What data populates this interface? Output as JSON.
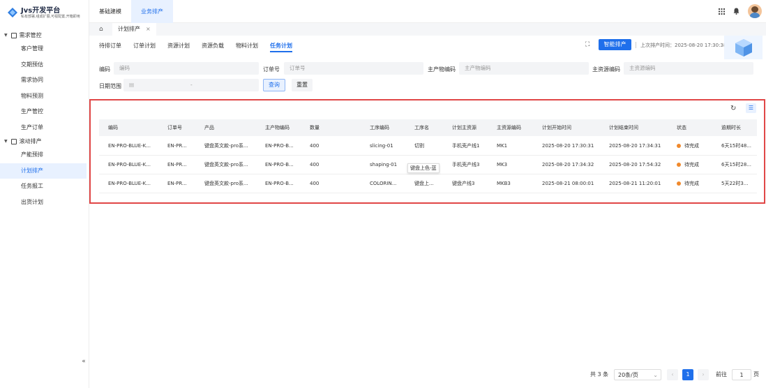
{
  "app": {
    "title": "Jvs开发平台",
    "subtitle": "私有部署,组成扩展,可视配置,开箱即用"
  },
  "topnav": [
    {
      "label": "基础建模",
      "active": false
    },
    {
      "label": "业务排产",
      "active": true
    }
  ],
  "sidebar": {
    "groups": [
      {
        "label": "需求管控",
        "items": [
          {
            "label": "客户管理",
            "active": false
          },
          {
            "label": "交期预估",
            "active": false
          },
          {
            "label": "需求协同",
            "active": false
          },
          {
            "label": "物料预测",
            "active": false
          },
          {
            "label": "生产管控",
            "active": false
          },
          {
            "label": "生产订单",
            "active": false
          }
        ]
      },
      {
        "label": "滚动排产",
        "items": [
          {
            "label": "产能预排",
            "active": false
          },
          {
            "label": "计划排产",
            "active": true
          },
          {
            "label": "任务报工",
            "active": false
          },
          {
            "label": "出货计划",
            "active": false
          }
        ]
      }
    ],
    "collapse_glyph": "«"
  },
  "page_tab": {
    "label": "计划排产",
    "close": "×"
  },
  "subtabs": [
    {
      "label": "待排订单",
      "active": false
    },
    {
      "label": "订单计划",
      "active": false
    },
    {
      "label": "资源计划",
      "active": false
    },
    {
      "label": "资源负载",
      "active": false
    },
    {
      "label": "物料计划",
      "active": false
    },
    {
      "label": "任务计划",
      "active": true
    }
  ],
  "toolbar": {
    "smart_button": "智能排产",
    "last_run": "上次排产时间：2025-08-20 17:30:38"
  },
  "filters": {
    "code_label": "编码",
    "code_placeholder": "编码",
    "order_label": "订单号",
    "order_placeholder": "订单号",
    "material_label": "主产物编码",
    "material_placeholder": "主产物编码",
    "resource_label": "主资源编码",
    "resource_placeholder": "主资源编码",
    "date_label": "日期范围",
    "date_sep": "-",
    "query_button": "查询",
    "reset_button": "重置"
  },
  "table": {
    "columns": [
      "编码",
      "订单号",
      "产品",
      "主产物编码",
      "数量",
      "工序编码",
      "工序名",
      "计划主资源",
      "主资源编码",
      "计划开始时间",
      "计划结束时间",
      "状态",
      "逾期时长"
    ],
    "rows": [
      [
        "EN-PRO-BLUE-K...",
        "EN-PR...",
        "键盘英文款-pro系...",
        "EN-PRO-B...",
        "400",
        "slicing-01",
        "切割",
        "手机壳产线1",
        "MK1",
        "2025-08-20 17:30:31",
        "2025-08-20 17:34:31",
        "待完成",
        "6天15时48..."
      ],
      [
        "EN-PRO-BLUE-K...",
        "EN-PR...",
        "键盘英文款-pro系...",
        "EN-PRO-B...",
        "400",
        "shaping-01",
        "",
        "手机壳产线3",
        "MK3",
        "2025-08-20 17:34:32",
        "2025-08-20 17:54:32",
        "待完成",
        "6天15时28..."
      ],
      [
        "EN-PRO-BLUE-K...",
        "EN-PR...",
        "键盘英文款-pro系...",
        "EN-PRO-B...",
        "400",
        "COLORIN...",
        "键盘上...",
        "键盘产线3",
        "MKB3",
        "2025-08-21 08:00:01",
        "2025-08-21 11:20:01",
        "待完成",
        "5天22时3..."
      ]
    ],
    "status_color": "#f0892c",
    "tooltip": "键盘上色-蓝"
  },
  "pagination": {
    "total": "共 3 条",
    "page_size": "20条/页",
    "prev": "‹",
    "current": "1",
    "next": "›",
    "goto_label": "前往",
    "goto_value": "1",
    "page_suffix": "页"
  },
  "colors": {
    "accent": "#1f6feb",
    "highlight_border": "#e04646"
  }
}
